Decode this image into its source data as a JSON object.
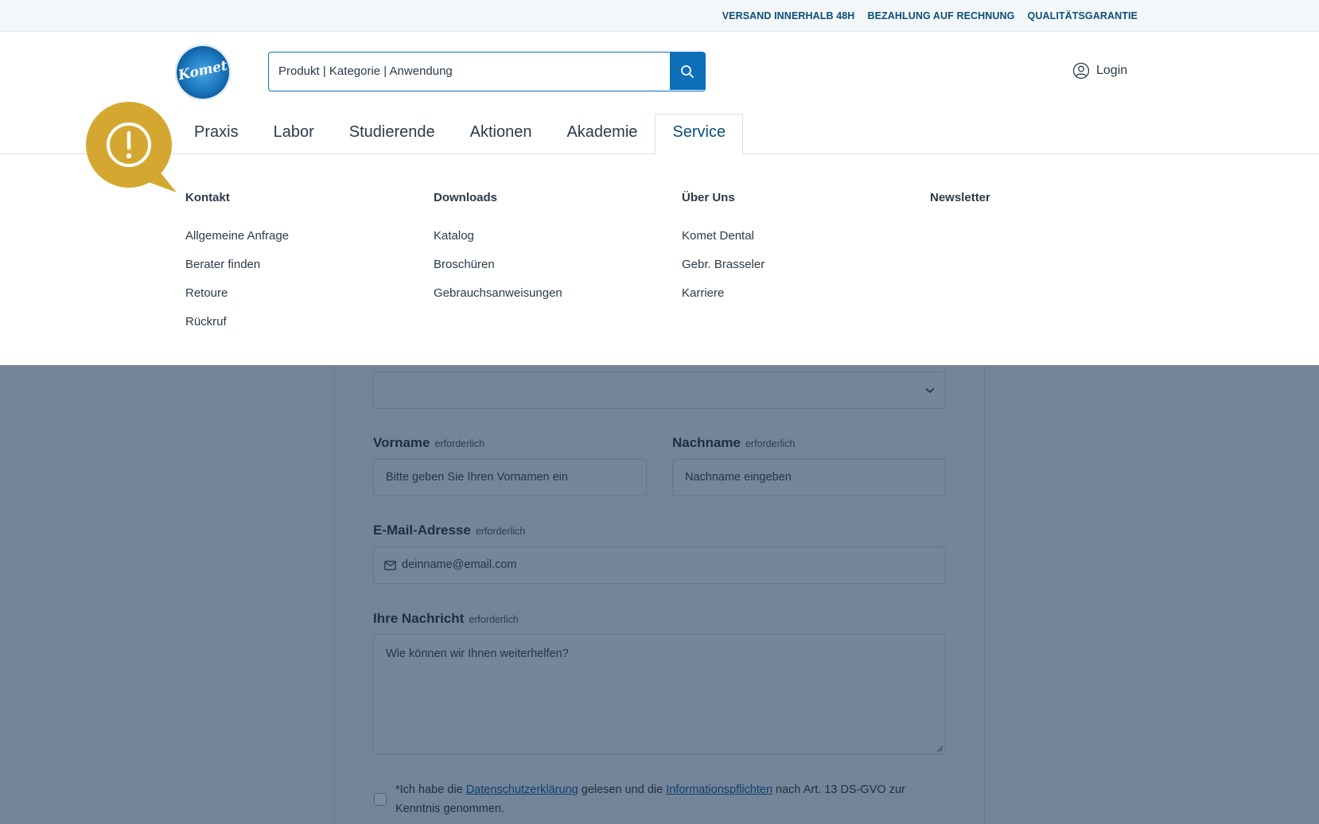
{
  "topbar": {
    "links": [
      "VERSAND INNERHALB 48H",
      "BEZAHLUNG AUF RECHNUNG",
      "QUALITÄTSGARANTIE"
    ]
  },
  "header": {
    "logo_text": "Komet",
    "search": {
      "placeholder": "Produkt | Kategorie | Anwendung"
    },
    "login_label": "Login"
  },
  "nav": {
    "items": [
      "Praxis",
      "Labor",
      "Studierende",
      "Aktionen",
      "Akademie",
      "Service"
    ],
    "active": "Service"
  },
  "mega_menu": {
    "columns": [
      {
        "heading": "Kontakt",
        "links": [
          "Allgemeine Anfrage",
          "Berater finden",
          "Retoure",
          "Rückruf"
        ]
      },
      {
        "heading": "Downloads",
        "links": [
          "Katalog",
          "Broschüren",
          "Gebrauchsanweisungen"
        ]
      },
      {
        "heading": "Über Uns",
        "links": [
          "Komet Dental",
          "Gebr. Brasseler",
          "Karriere"
        ]
      },
      {
        "heading": "Newsletter",
        "links": []
      }
    ]
  },
  "form": {
    "required_label": "erforderlich",
    "first_name": {
      "label": "Vorname",
      "placeholder": "Bitte geben Sie Ihren Vornamen ein"
    },
    "last_name": {
      "label": "Nachname",
      "placeholder": "Nachname eingeben"
    },
    "email": {
      "label": "E-Mail-Adresse",
      "placeholder": "deinname@email.com"
    },
    "message": {
      "label": "Ihre Nachricht",
      "placeholder": "Wie können wir Ihnen weiterhelfen?"
    },
    "consent": {
      "prefix": "*Ich habe die",
      "link1": "Datenschutzerklärung",
      "middle": "gelesen und die",
      "link2": "Informationspflichten",
      "suffix": "nach Art. 13 DS-GVO zur Kenntnis genommen."
    }
  },
  "colors": {
    "brand_blue": "#0c6fb8",
    "nav_active": "#0b4f7a",
    "overlay": "#748599",
    "feedback_gold": "#d4a830"
  }
}
